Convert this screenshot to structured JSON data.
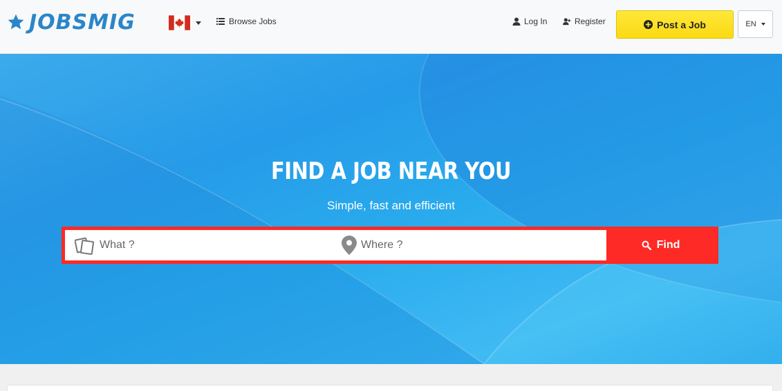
{
  "header": {
    "logo_text": "JOBSMIG",
    "country_flag": "canada-flag",
    "browse_jobs_label": "Browse Jobs",
    "login_label": "Log In",
    "register_label": "Register",
    "post_job_label": "Post a Job",
    "language_label": "EN"
  },
  "hero": {
    "title": "FIND A JOB NEAR YOU",
    "subtitle": "Simple, fast and efficient"
  },
  "search": {
    "what_placeholder": "What ?",
    "where_placeholder": "Where ?",
    "find_label": "Find"
  },
  "colors": {
    "logo_blue": "#2b86c9",
    "post_button_yellow": "#fde12a",
    "search_red": "#fe2a25",
    "hero_blue": "#1a9ce8"
  }
}
